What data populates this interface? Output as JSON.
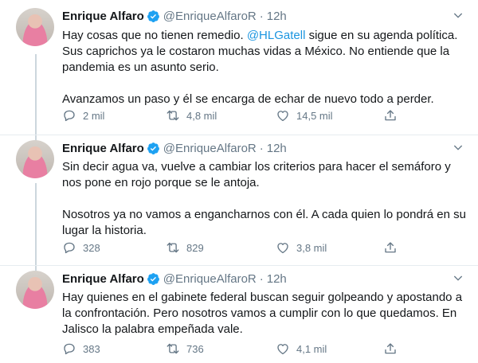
{
  "tweets": [
    {
      "name": "Enrique Alfaro",
      "handle": "@EnriqueAlfaroR",
      "dot": "·",
      "time": "12h",
      "p1_a": "Hay cosas que no tienen remedio. ",
      "mention": "@HLGatell",
      "p1_b": " sigue en su agenda política. Sus caprichos ya le costaron muchas vidas a México. No entiende que la pandemia es un asunto serio.",
      "p2": "Avanzamos un paso y él se encarga de echar de nuevo todo a perder.",
      "replies": "2 mil",
      "retweets": "4,8 mil",
      "likes": "14,5 mil"
    },
    {
      "name": "Enrique Alfaro",
      "handle": "@EnriqueAlfaroR",
      "dot": "·",
      "time": "12h",
      "p1": "Sin decir agua va, vuelve a cambiar los criterios para hacer el semáforo y nos pone en rojo porque se le antoja.",
      "p2": "Nosotros ya no vamos a engancharnos con él. A cada quien lo pondrá en su lugar la historia.",
      "replies": "328",
      "retweets": "829",
      "likes": "3,8 mil"
    },
    {
      "name": "Enrique Alfaro",
      "handle": "@EnriqueAlfaroR",
      "dot": "·",
      "time": "12h",
      "p1": "Hay quienes en el gabinete federal buscan seguir golpeando y apostando a la confrontación. Pero nosotros vamos a cumplir con lo que quedamos. En Jalisco la palabra empeñada vale.",
      "replies": "383",
      "retweets": "736",
      "likes": "4,1 mil"
    }
  ],
  "colors": {
    "link": "#1b95e0",
    "muted": "#657786",
    "verified": "#1da1f2",
    "thread": "#ccd6dd"
  },
  "icons": [
    "verified-badge-icon",
    "chevron-down-icon",
    "reply-icon",
    "retweet-icon",
    "like-icon",
    "share-icon"
  ]
}
